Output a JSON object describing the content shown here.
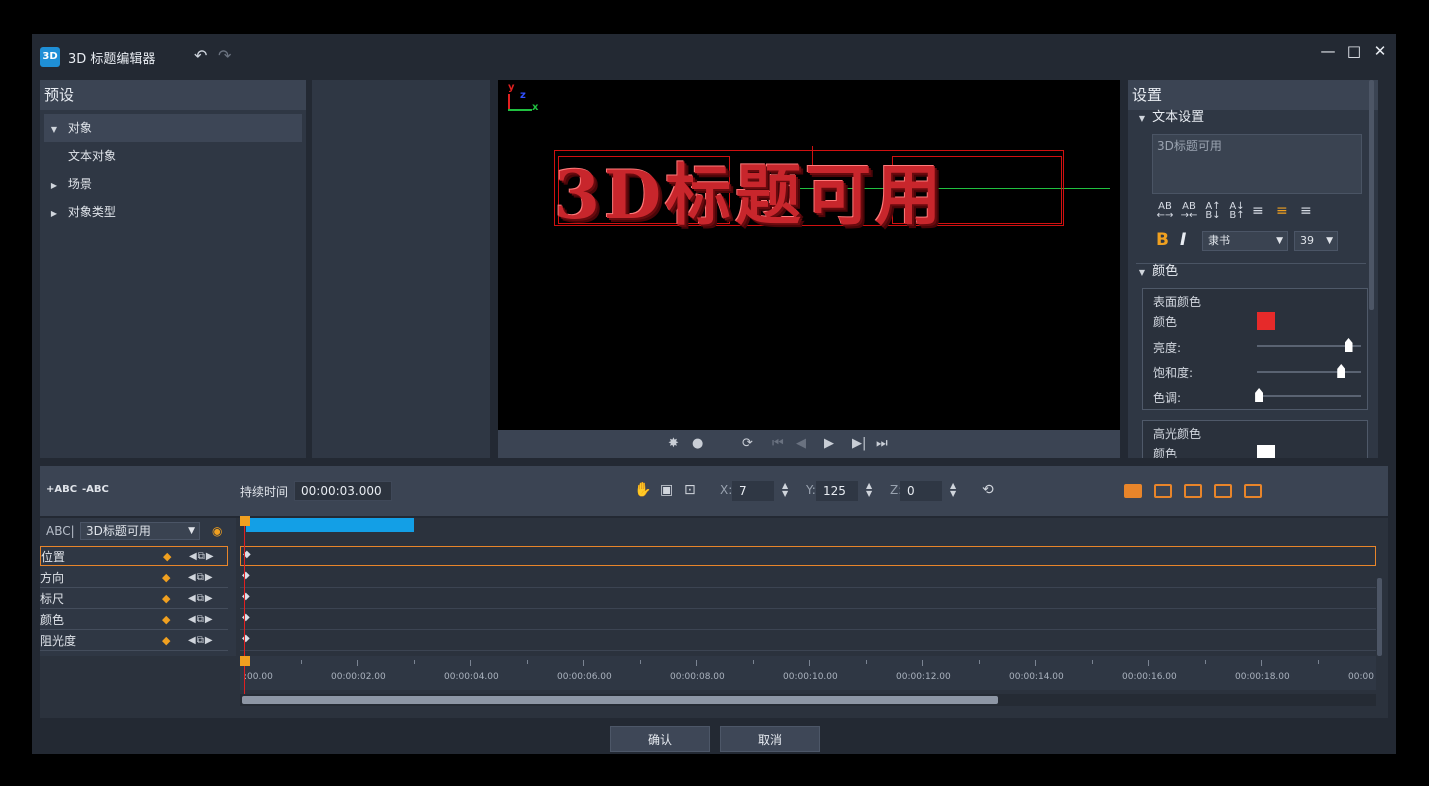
{
  "window": {
    "icon_text": "3D",
    "title": "3D 标题编辑器",
    "controls": {
      "minimize": "—",
      "maximize": "□",
      "close": "✕"
    }
  },
  "preset": {
    "header": "预设",
    "items": [
      {
        "label": "对象",
        "expanded": true
      },
      {
        "label": "文本对象"
      },
      {
        "label": "场景",
        "expanded": false
      },
      {
        "label": "对象类型",
        "expanded": false
      }
    ]
  },
  "viewport": {
    "title_text": "3D标题可用",
    "axis_x": "x",
    "axis_y": "y",
    "axis_z": "z",
    "text_color": "#c8262c"
  },
  "settings": {
    "header": "设置",
    "text_section": "文本设置",
    "text_value": "3D标题可用",
    "format_buttons": [
      "AB\n←→",
      "AB\n→←",
      "A↑\nB↓",
      "A↓\nB↑"
    ],
    "bold": "B",
    "italic": "I",
    "font": "隶书",
    "font_size": "39",
    "color_section": "颜色",
    "surface_color": {
      "title": "表面颜色",
      "color_label": "颜色",
      "color": "#e62a2a",
      "brightness_label": "亮度:",
      "brightness": 0.88,
      "saturation_label": "饱和度:",
      "saturation": 0.81,
      "hue_label": "色调:",
      "hue": 0.02
    },
    "highlight_color": {
      "title": "高光颜色",
      "color_label": "颜色",
      "color": "#ffffff"
    }
  },
  "timeline": {
    "add_abc": "+ABC",
    "remove_abc": "-ABC",
    "duration_label": "持续时间",
    "duration_value": "00:00:03.000",
    "x_label": "X:",
    "x_value": "7",
    "y_label": "Y:",
    "y_value": "125",
    "z_label": "Z:",
    "z_value": "0",
    "object_prefix": "ABC|",
    "object_name": "3D标题可用",
    "tracks": [
      "位置",
      "方向",
      "标尺",
      "颜色",
      "阻光度"
    ],
    "ruler_labels": [
      ":00.00",
      "00:00:02.00",
      "00:00:04.00",
      "00:00:06.00",
      "00:00:08.00",
      "00:00:10.00",
      "00:00:12.00",
      "00:00:14.00",
      "00:00:16.00",
      "00:00:18.00",
      "00:00"
    ]
  },
  "dialog": {
    "ok": "确认",
    "cancel": "取消"
  }
}
